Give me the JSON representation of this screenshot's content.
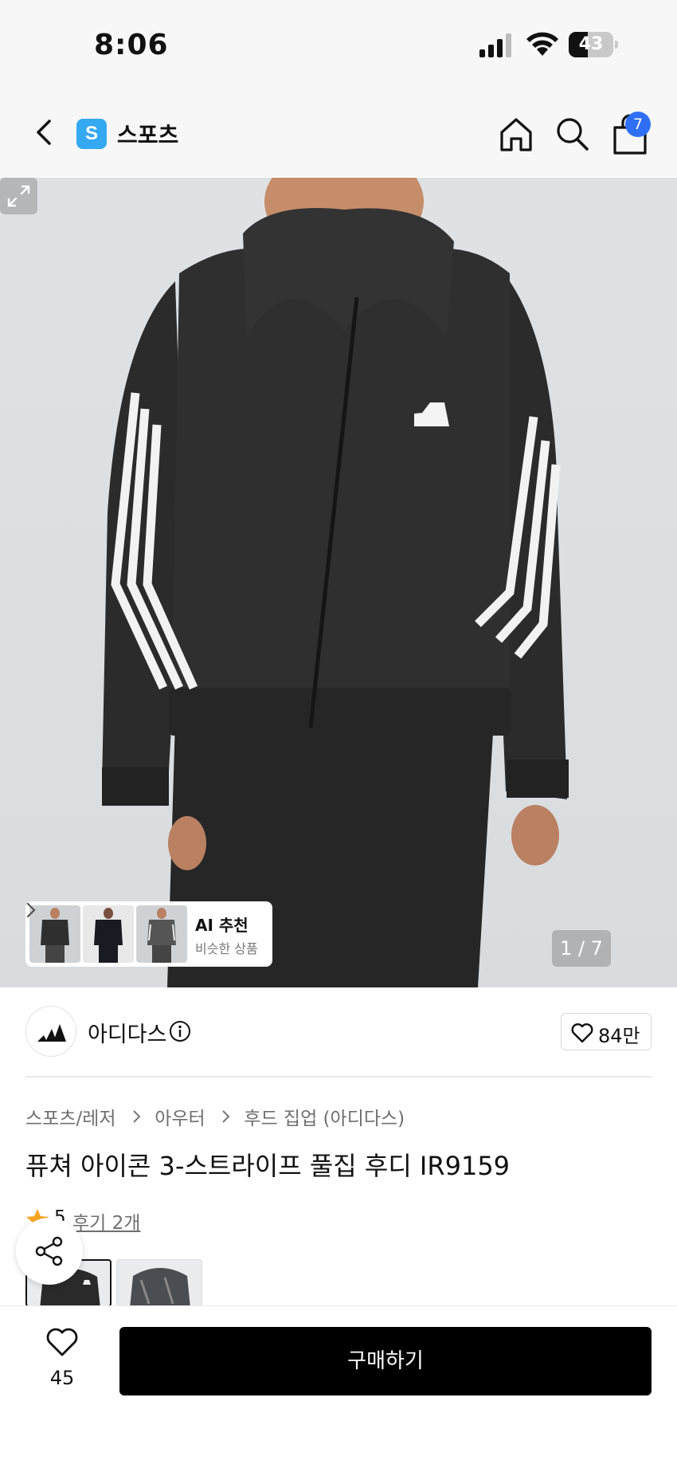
{
  "status_bar": {
    "time": "8:06",
    "battery_level": "43",
    "icons": [
      "signal-icon",
      "wifi-icon",
      "battery-icon"
    ]
  },
  "nav": {
    "logo_letter": "S",
    "store_name": "스포츠",
    "cart_count": "7",
    "icons": [
      "back-icon",
      "home-icon",
      "search-icon",
      "cart-icon"
    ],
    "logo_color": "#35a8f2",
    "badge_color": "#2f6ff5"
  },
  "gallery": {
    "ai_title": "AI 추천",
    "ai_subtitle": "비슷한 상품",
    "page_counter": "1 / 7",
    "thumbnail_count": 3
  },
  "brand": {
    "name": "아디다스",
    "likes": "84만"
  },
  "breadcrumb": [
    "스포츠/레저",
    "아우터",
    "후드 집업 (아디다스)"
  ],
  "product": {
    "title": "퓨쳐 아이콘 3-스트라이프 풀집 후디 IR9159",
    "rating": "5",
    "reviews_link": "후기 2개",
    "star_color": "#f5a623"
  },
  "bottom": {
    "wish_count": "45",
    "buy_label": "구매하기"
  }
}
